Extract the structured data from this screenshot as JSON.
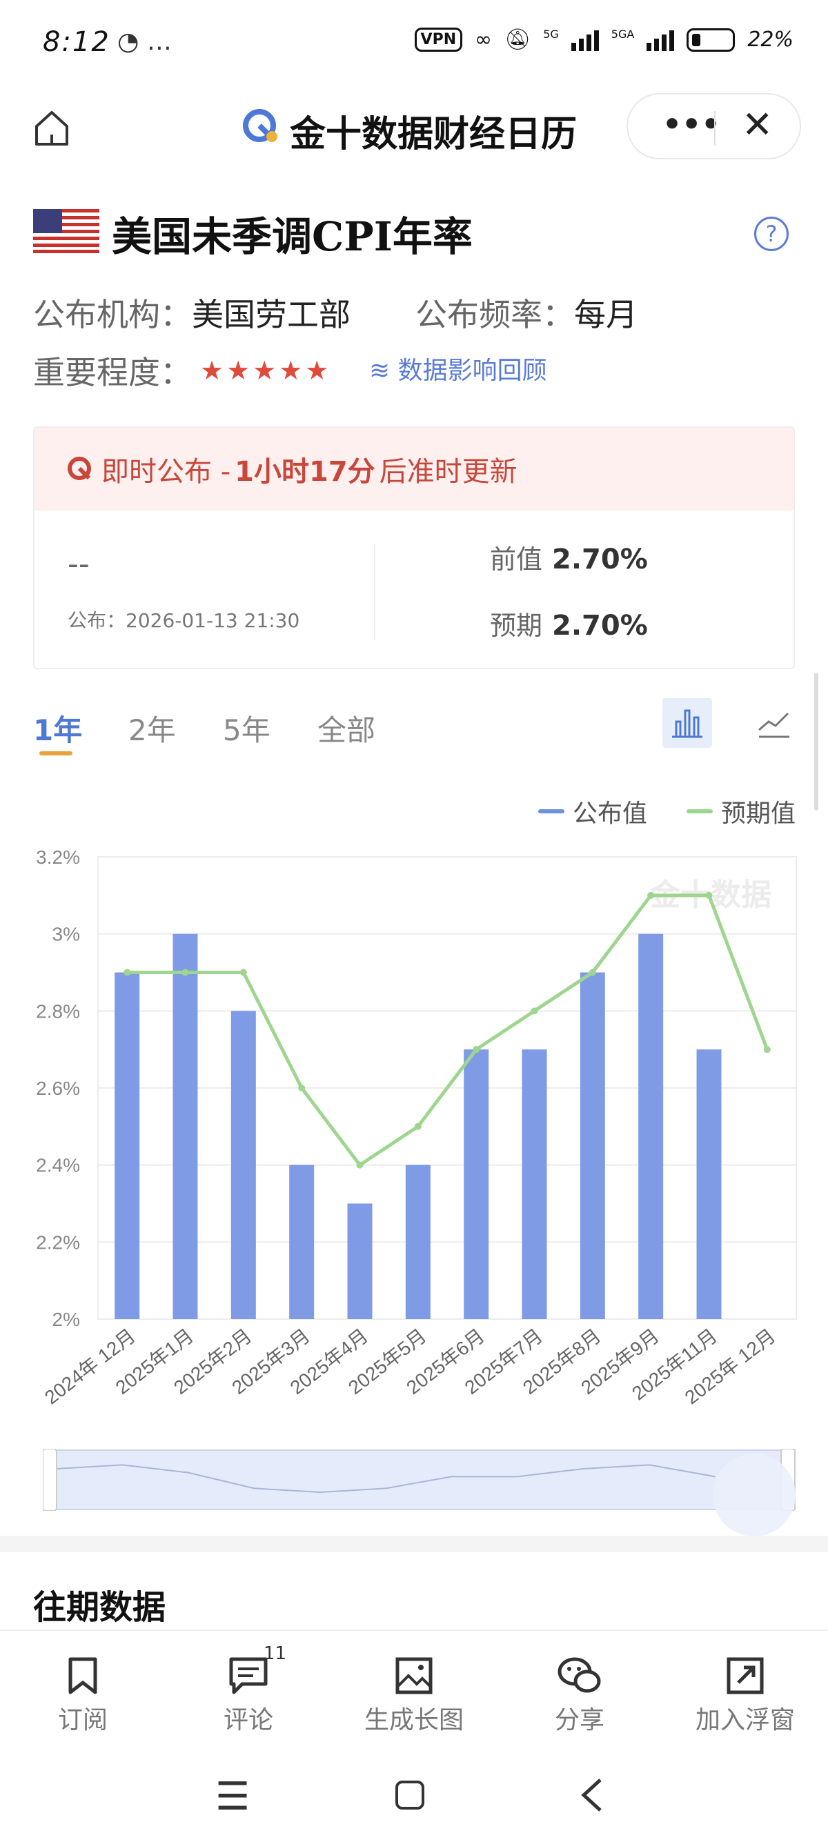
{
  "status_bar": {
    "time": "8:12",
    "extra": "…",
    "vpn": "VPN",
    "network1": "5G",
    "network2": "5GA",
    "battery": "22%"
  },
  "header": {
    "title": "金十数据财经日历"
  },
  "indicator": {
    "title": "美国未季调CPI年率",
    "publisher_label": "公布机构：",
    "publisher": "美国劳工部",
    "frequency_label": "公布频率：",
    "frequency": "每月",
    "importance_label": "重要程度：",
    "stars": "★★★★★",
    "review_link": "数据影响回顾"
  },
  "release": {
    "banner_prefix": "即时公布 -",
    "banner_time": "1小时17分",
    "banner_suffix": "后准时更新",
    "actual": "--",
    "publish_time": "公布：2026-01-13 21:30",
    "previous_label": "前值",
    "previous": "2.70%",
    "forecast_label": "预期",
    "forecast": "2.70%"
  },
  "range_tabs": [
    "1年",
    "2年",
    "5年",
    "全部"
  ],
  "legend": {
    "actual": "公布值",
    "expected": "预期值"
  },
  "watermark": "金十数据",
  "chart_data": {
    "type": "bar",
    "categories": [
      "2024年 12月",
      "2025年1月",
      "2025年2月",
      "2025年3月",
      "2025年4月",
      "2025年5月",
      "2025年6月",
      "2025年7月",
      "2025年8月",
      "2025年9月",
      "2025年11月",
      "2025年 12月"
    ],
    "series": [
      {
        "name": "公布值",
        "type": "bar",
        "values": [
          2.9,
          3.0,
          2.8,
          2.4,
          2.3,
          2.4,
          2.7,
          2.7,
          2.9,
          3.0,
          2.7,
          null
        ]
      },
      {
        "name": "预期值",
        "type": "line",
        "values": [
          2.9,
          2.9,
          2.9,
          2.6,
          2.4,
          2.5,
          2.7,
          2.8,
          2.9,
          3.1,
          3.1,
          2.7
        ]
      }
    ],
    "yticks": [
      "3.2%",
      "3%",
      "2.8%",
      "2.6%",
      "2.4%",
      "2.2%",
      "2%"
    ],
    "ylim": [
      2.0,
      3.2
    ],
    "colors": {
      "bar": "#7f9be6",
      "line": "#9ed68f"
    },
    "grid": true,
    "legend": "top-right"
  },
  "history_title": "往期数据",
  "actions": [
    {
      "label": "订阅",
      "icon": "bookmark-icon"
    },
    {
      "label": "评论",
      "icon": "comment-icon",
      "badge": "11"
    },
    {
      "label": "生成长图",
      "icon": "image-icon"
    },
    {
      "label": "分享",
      "icon": "wechat-icon"
    },
    {
      "label": "加入浮窗",
      "icon": "float-window-icon"
    }
  ]
}
